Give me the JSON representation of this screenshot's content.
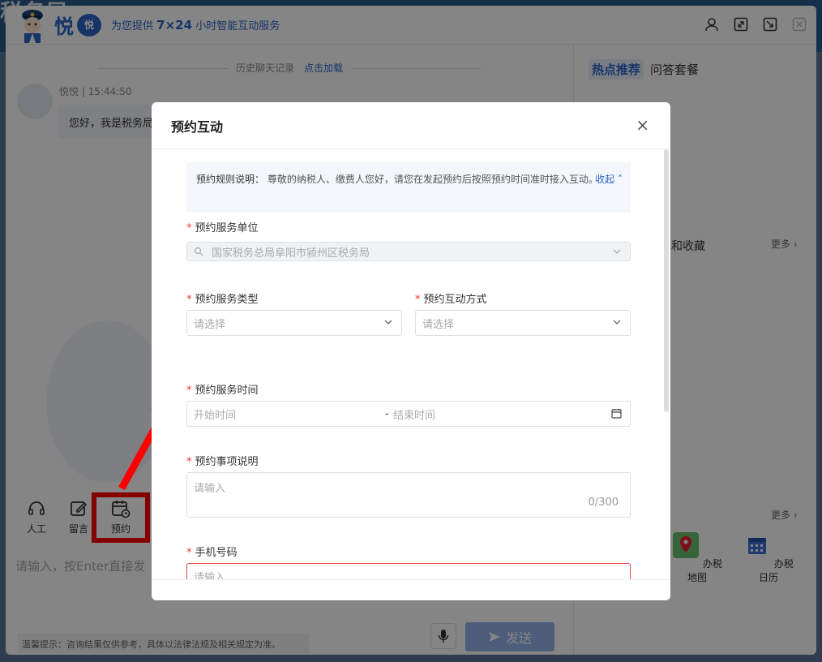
{
  "background": {
    "title": "税务局"
  },
  "header": {
    "brand": "悦",
    "brand_badge": "悦",
    "slogan_prefix": "为您提供",
    "slogan_highlight": "7×24",
    "slogan_suffix": "小时智能互动服务"
  },
  "chat": {
    "history_label": "历史聊天记录",
    "load_link": "点击加载",
    "message": {
      "sender": "悦悦 | 15:44:50",
      "text": "您好，我是税务局"
    },
    "tools": [
      {
        "label": "人工",
        "icon": "headset-icon"
      },
      {
        "label": "留言",
        "icon": "edit-icon"
      },
      {
        "label": "预约",
        "icon": "calendar-clock-icon"
      }
    ],
    "input_placeholder": "请输入，按Enter直接发",
    "tips": "温馨提示：咨询结果仅供参考，具体以法律法规及相关规定为准。",
    "send_label": "发送"
  },
  "sidebar": {
    "tabs": [
      "热点推荐",
      "问答套餐"
    ],
    "favorites": "和收藏",
    "more1": "更多 ›",
    "more2": "更多 ›",
    "shortcuts": [
      {
        "label": "办税地图",
        "icon": "map-icon"
      },
      {
        "label": "办税日历",
        "icon": "calendar-icon"
      }
    ]
  },
  "modal": {
    "title": "预约互动",
    "close": "×",
    "rules_label": "预约规则说明：",
    "rules_text": "尊敬的纳税人、缴费人您好，请您在发起预约后按照预约时间准时接入互动。",
    "collapse": "收起",
    "fields": {
      "unit": {
        "label": "预约服务单位",
        "value": "国家税务总局阜阳市颍州区税务局"
      },
      "type": {
        "label": "预约服务类型",
        "placeholder": "请选择"
      },
      "method": {
        "label": "预约互动方式",
        "placeholder": "请选择"
      },
      "time": {
        "label": "预约服务时间",
        "start": "开始时间",
        "separator": "-",
        "end": "结束时间"
      },
      "desc": {
        "label": "预约事项说明",
        "placeholder": "请输入",
        "count": "0/300"
      },
      "phone": {
        "label": "手机号码",
        "placeholder": "请输入"
      }
    }
  },
  "colors": {
    "accent": "#2c64c8",
    "required": "#e33333",
    "highlight": "#ff0000"
  }
}
